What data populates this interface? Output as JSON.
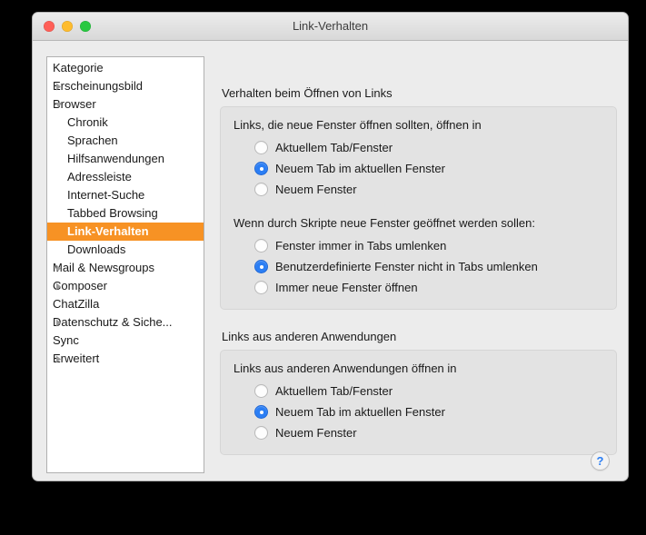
{
  "window": {
    "title": "Link-Verhalten",
    "traffic_lights": [
      {
        "name": "close",
        "color": "#ff5f57"
      },
      {
        "name": "minimize",
        "color": "#febc2e"
      },
      {
        "name": "zoom",
        "color": "#28c840"
      }
    ]
  },
  "sidebar": {
    "header": "Kategorie",
    "selection_color": "#f79224",
    "items": [
      {
        "label": "Erscheinungsbild",
        "depth": 0,
        "twisty": "collapsed",
        "selected": false
      },
      {
        "label": "Browser",
        "depth": 0,
        "twisty": "expanded",
        "selected": false
      },
      {
        "label": "Chronik",
        "depth": 1,
        "twisty": "none",
        "selected": false
      },
      {
        "label": "Sprachen",
        "depth": 1,
        "twisty": "none",
        "selected": false
      },
      {
        "label": "Hilfsanwendungen",
        "depth": 1,
        "twisty": "none",
        "selected": false
      },
      {
        "label": "Adressleiste",
        "depth": 1,
        "twisty": "none",
        "selected": false
      },
      {
        "label": "Internet-Suche",
        "depth": 1,
        "twisty": "none",
        "selected": false
      },
      {
        "label": "Tabbed Browsing",
        "depth": 1,
        "twisty": "none",
        "selected": false
      },
      {
        "label": "Link-Verhalten",
        "depth": 1,
        "twisty": "none",
        "selected": true
      },
      {
        "label": "Downloads",
        "depth": 1,
        "twisty": "none",
        "selected": false
      },
      {
        "label": "Mail & Newsgroups",
        "depth": 0,
        "twisty": "collapsed",
        "selected": false
      },
      {
        "label": "Composer",
        "depth": 0,
        "twisty": "collapsed",
        "selected": false
      },
      {
        "label": "ChatZilla",
        "depth": 0,
        "twisty": "none",
        "selected": false
      },
      {
        "label": "Datenschutz & Siche...",
        "depth": 0,
        "twisty": "collapsed",
        "selected": false
      },
      {
        "label": "Sync",
        "depth": 0,
        "twisty": "none",
        "selected": false
      },
      {
        "label": "Erweitert",
        "depth": 0,
        "twisty": "collapsed",
        "selected": false
      }
    ]
  },
  "main": {
    "sections": [
      {
        "title": "Verhalten beim Öffnen von Links",
        "groups": [
          {
            "heading": "Links, die neue Fenster öffnen sollten, öffnen in",
            "options": [
              {
                "label": "Aktuellem Tab/Fenster",
                "checked": false
              },
              {
                "label": "Neuem Tab im aktuellen Fenster",
                "checked": true
              },
              {
                "label": "Neuem Fenster",
                "checked": false
              }
            ]
          },
          {
            "heading": "Wenn durch Skripte neue Fenster geöffnet werden sollen:",
            "options": [
              {
                "label": "Fenster immer in Tabs umlenken",
                "checked": false
              },
              {
                "label": "Benutzerdefinierte Fenster nicht in Tabs umlenken",
                "checked": true
              },
              {
                "label": "Immer neue Fenster öffnen",
                "checked": false
              }
            ]
          }
        ]
      },
      {
        "title": "Links aus anderen Anwendungen",
        "groups": [
          {
            "heading": "Links aus anderen Anwendungen öffnen in",
            "options": [
              {
                "label": "Aktuellem Tab/Fenster",
                "checked": false
              },
              {
                "label": "Neuem Tab im aktuellen Fenster",
                "checked": true
              },
              {
                "label": "Neuem Fenster",
                "checked": false
              }
            ]
          }
        ]
      }
    ]
  },
  "help": {
    "label": "?"
  }
}
